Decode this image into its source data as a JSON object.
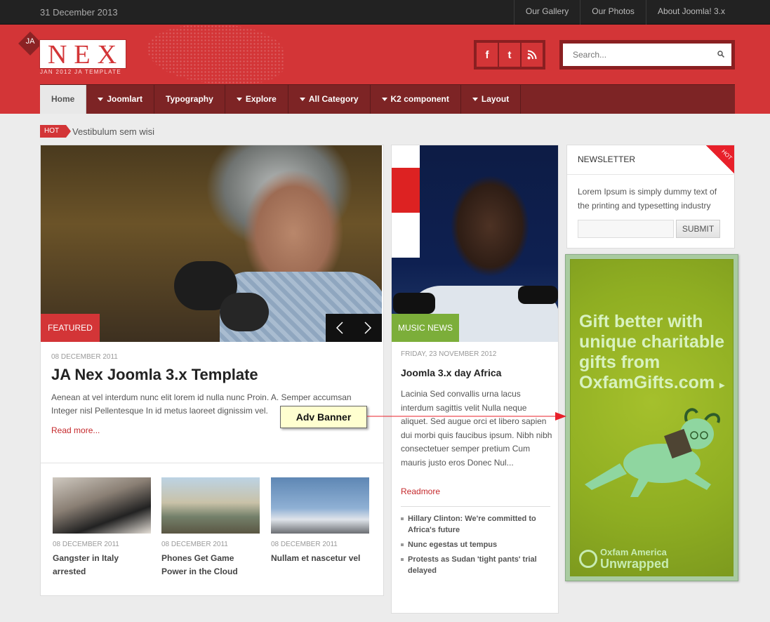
{
  "topbar": {
    "date": "31 December 2013",
    "links": [
      "Our Gallery",
      "Our Photos",
      "About Joomla! 3.x"
    ]
  },
  "logo": {
    "badge": "JA",
    "name": "NEX",
    "tagline": "JAN 2012 JA TEMPLATE"
  },
  "social": {
    "icons": [
      "facebook-icon",
      "twitter-icon",
      "rss-icon"
    ],
    "facebook": "f",
    "twitter": "t"
  },
  "search": {
    "placeholder": "Search..."
  },
  "nav": {
    "items": [
      "Home",
      "Joomlart",
      "Typography",
      "Explore",
      "All Category",
      "K2 component",
      "Layout"
    ]
  },
  "hot": {
    "badge": "HOT",
    "text": "Vestibulum sem wisi"
  },
  "featured": {
    "label": "FEATURED",
    "date": "08 DECEMBER 2011",
    "title": "JA Nex Joomla 3.x Template",
    "description": "Aenean at vel interdum nunc elit lorem id nulla nunc Proin. A. Semper accumsan Integer nisl Pellentesque In id metus laoreet dignissim vel.",
    "read_more": "Read more...",
    "thumbs": [
      {
        "date": "08 DECEMBER 2011",
        "title": "Gangster in Italy arrested"
      },
      {
        "date": "08 DECEMBER 2011",
        "title": "Phones Get Game Power in the Cloud"
      },
      {
        "date": "08 DECEMBER 2011",
        "title": "Nullam et nascetur vel"
      }
    ]
  },
  "music": {
    "label": "MUSIC NEWS",
    "date": "FRIDAY, 23 NOVEMBER 2012",
    "title": "Joomla 3.x day Africa",
    "description": "Lacinia Sed convallis urna lacus interdum sagittis velit Nulla neque aliquet. Sed augue orci et libero sapien dui morbi quis faucibus ipsum. Nibh nibh consectetuer semper pretium Cum mauris justo eros Donec Nul...",
    "read_more": "Readmore",
    "links": [
      "Hillary Clinton: We're committed to Africa's future",
      "Nunc egestas ut tempus",
      "Protests as Sudan 'tight pants' trial delayed"
    ]
  },
  "newsletter": {
    "title": "NEWSLETTER",
    "corner": "HOT",
    "text": "Lorem Ipsum is simply dummy text of the printing and typesetting industry",
    "submit": "SUBMIT"
  },
  "ad": {
    "headline": "Gift better with unique charitable gifts from OxfamGifts.com",
    "brand_top": "Oxfam America",
    "brand_bottom": "Unwrapped"
  },
  "annotation": {
    "label": "Adv Banner"
  },
  "colors": {
    "brand_red": "#d33537",
    "nav_dark": "#7d2425",
    "music_green": "#7cae3a",
    "annotation_arrow": "#e8202a"
  }
}
